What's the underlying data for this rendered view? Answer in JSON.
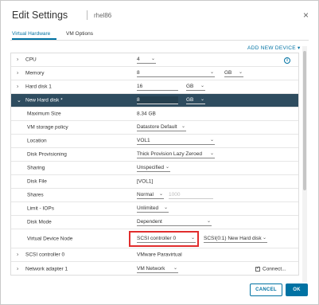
{
  "dialog": {
    "title": "Edit Settings",
    "subtitle": "rhel86",
    "close_glyph": "×"
  },
  "tabs": [
    {
      "label": "Virtual Hardware",
      "active": true
    },
    {
      "label": "VM Options",
      "active": false
    }
  ],
  "add_device_label": "ADD NEW DEVICE",
  "add_device_caret": "▾",
  "info_glyph": "i",
  "rows": {
    "cpu": {
      "label": "CPU",
      "value": "4"
    },
    "memory": {
      "label": "Memory",
      "value": "8",
      "unit": "GB"
    },
    "hard_disk_1": {
      "label": "Hard disk 1",
      "value": "16",
      "unit": "GB"
    },
    "new_hard_disk": {
      "label": "New Hard disk *",
      "value": "8",
      "unit": "GB"
    },
    "maximum_size": {
      "label": "Maximum Size",
      "value": "8.34 GB"
    },
    "vm_storage_policy": {
      "label": "VM storage policy",
      "value": "Datastore Default"
    },
    "location": {
      "label": "Location",
      "value": "VOL1"
    },
    "disk_provisioning": {
      "label": "Disk Provisioning",
      "value": "Thick Provision Lazy Zeroed"
    },
    "sharing": {
      "label": "Sharing",
      "value": "Unspecified"
    },
    "disk_file": {
      "label": "Disk File",
      "value": "[VOL1]"
    },
    "shares": {
      "label": "Shares",
      "value": "Normal",
      "value2": "1000"
    },
    "limit_iops": {
      "label": "Limit - IOPs",
      "value": "Unlimited"
    },
    "disk_mode": {
      "label": "Disk Mode",
      "value": "Dependent"
    },
    "virtual_device_node": {
      "label": "Virtual Device Node",
      "value": "SCSI controller 0",
      "value2": "SCSI(0:1) New Hard disk"
    },
    "scsi_controller_0": {
      "label": "SCSI controller 0",
      "value": "VMware Paravirtual"
    },
    "network_adapter_1": {
      "label": "Network adapter 1",
      "value": "VM Network",
      "connect_label": "Connect..."
    }
  },
  "buttons": {
    "cancel": "CANCEL",
    "ok": "OK"
  },
  "colors": {
    "accent": "#0072a3",
    "selected_row": "#2e4c5f",
    "highlight_box": "#e12d2d"
  },
  "icons": {
    "expand": "›",
    "collapse": "⌄",
    "caret": "⌄"
  }
}
